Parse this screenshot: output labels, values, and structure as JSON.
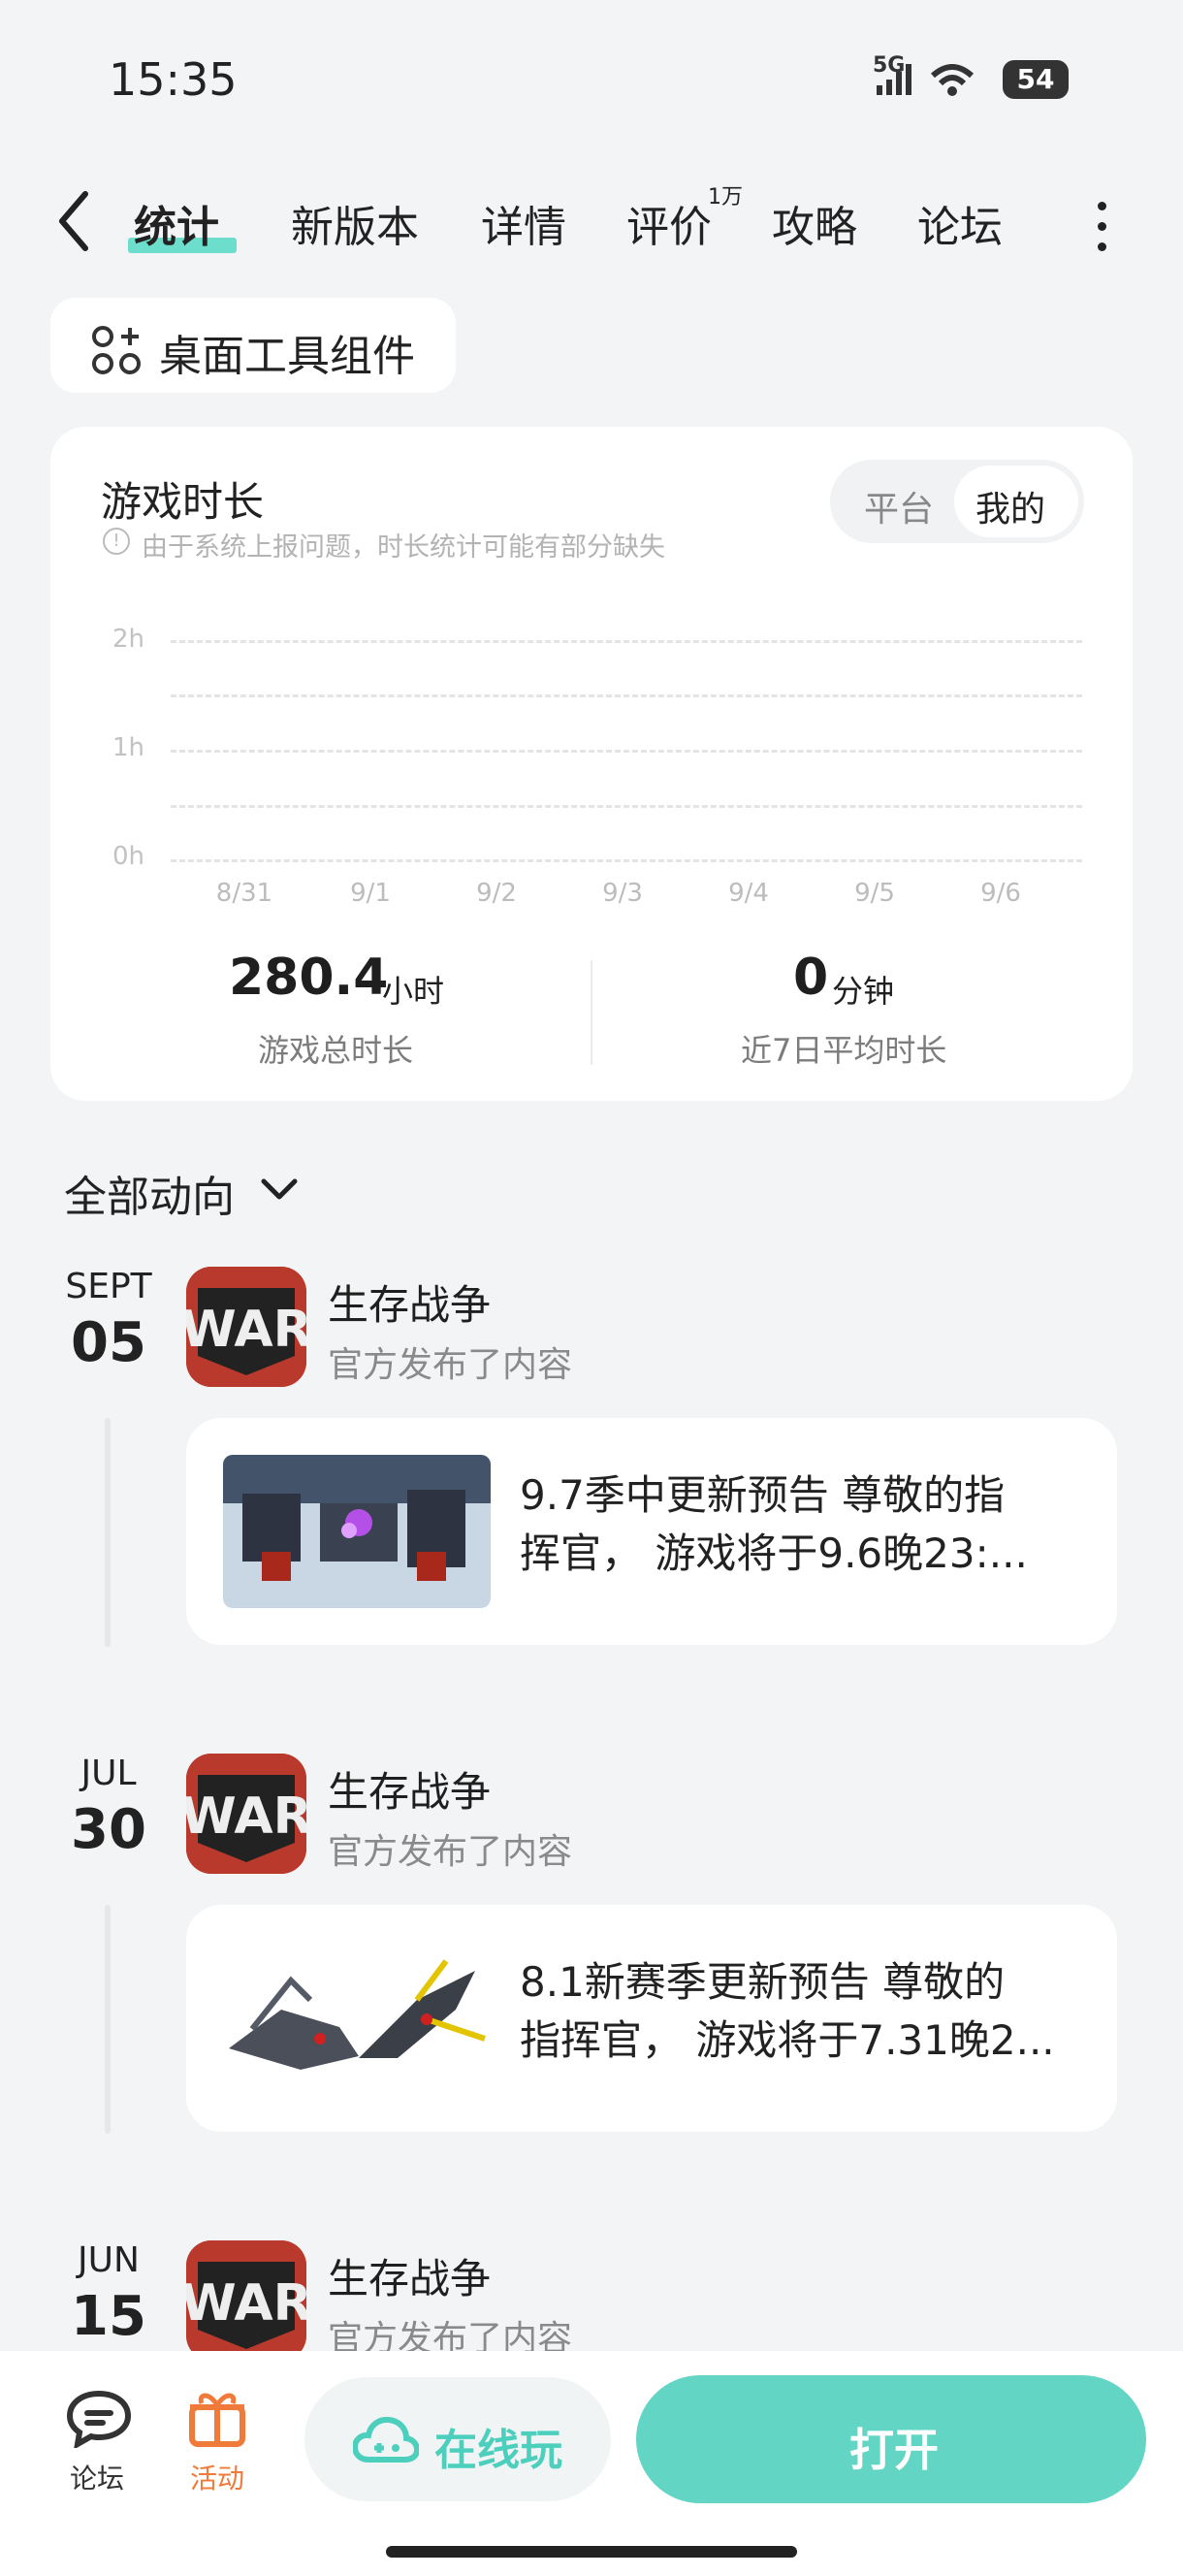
{
  "status": {
    "time": "15:35",
    "network": "5G",
    "battery": "54"
  },
  "tabs": [
    {
      "label": "统计",
      "active": true
    },
    {
      "label": "新版本"
    },
    {
      "label": "详情"
    },
    {
      "label": "评价",
      "badge": "1万"
    },
    {
      "label": "攻略"
    },
    {
      "label": "论坛"
    }
  ],
  "widget": {
    "label": "桌面工具组件"
  },
  "stats": {
    "title": "游戏时长",
    "notice": "由于系统上报问题，时长统计可能有部分缺失",
    "toggle": {
      "option_a": "平台",
      "option_b": "我的",
      "selected": "我的"
    },
    "total": {
      "value": "280.4",
      "unit": "小时",
      "label": "游戏总时长"
    },
    "avg": {
      "value": "0",
      "unit": "分钟",
      "label": "近7日平均时长"
    }
  },
  "chart_data": {
    "type": "bar",
    "categories": [
      "8/31",
      "9/1",
      "9/2",
      "9/3",
      "9/4",
      "9/5",
      "9/6"
    ],
    "values": [
      0,
      0,
      0,
      0,
      0,
      0,
      0
    ],
    "yticks": [
      "2h",
      "1h",
      "0h"
    ],
    "ylim": [
      0,
      2
    ],
    "grid": true
  },
  "feed": {
    "filter_label": "全部动向",
    "items": [
      {
        "month": "SEPT",
        "day": "05",
        "app": "生存战争",
        "sub": "官方发布了内容",
        "text1": "9.7季中更新预告 尊敬的指",
        "text2": "挥官， 游戏将于9.6晚23:..."
      },
      {
        "month": "JUL",
        "day": "30",
        "app": "生存战争",
        "sub": "官方发布了内容",
        "text1": "8.1新赛季更新预告 尊敬的",
        "text2": "指挥官， 游戏将于7.31晚2..."
      },
      {
        "month": "JUN",
        "day": "15",
        "app": "生存战争",
        "sub": "官方发布了内容"
      }
    ]
  },
  "bottom": {
    "forum": "论坛",
    "activity": "活动",
    "online": "在线玩",
    "open": "打开"
  },
  "colors": {
    "accent": "#62d5c4",
    "activity": "#f07a3a",
    "app_icon": "#b93a2c"
  }
}
